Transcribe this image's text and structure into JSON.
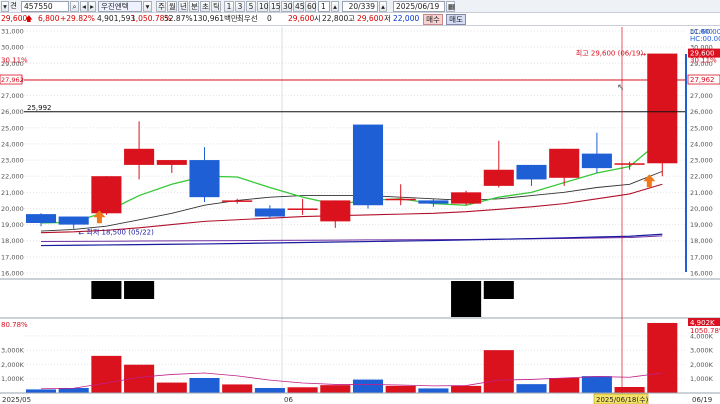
{
  "toolbar": {
    "prefix_label": "견",
    "stock_code": "457550",
    "stock_name": "우진엔텍",
    "period_tabs": [
      "주",
      "월",
      "년",
      "분",
      "초",
      "틱"
    ],
    "interval_buttons": [
      "1",
      "3",
      "5",
      "10",
      "15",
      "30",
      "45",
      "60",
      "1"
    ],
    "page_count": "20/339",
    "date": "2025/06/19",
    "buy_label": "매수",
    "sell_label": "매도"
  },
  "quote": {
    "price": "29,600",
    "change": "6,800",
    "change_pct": "+29.82%",
    "volume": "4,901,593",
    "volume_ratio": "1,050.78%",
    "turnover_ratio": "52.87%",
    "amount": "130,961백만",
    "preferred_label": "최우선",
    "preferred_value": "0",
    "open_value": "29,600",
    "open_label": "시",
    "low_value": "22,800",
    "high_label": "고",
    "high_value": "29,600",
    "low_label": "저",
    "close_value": "22,000"
  },
  "price_axis": {
    "ticks": [
      "31,000",
      "30,000",
      "29,000",
      "28,000",
      "27,000",
      "26,000",
      "25,000",
      "24,000",
      "23,000",
      "22,000",
      "21,000",
      "20,000",
      "19,000",
      "18,000",
      "17,000",
      "16,000"
    ],
    "left_ticks": [
      "30.11%"
    ],
    "lc_label": "LC:60.00",
    "hc_label": "HC:00.00",
    "current_price_tag": "29,600",
    "current_pct_tag": "30.11%",
    "ref_tag": "27,962",
    "ref_tag_left": "27,962",
    "level_line_label": "25,992",
    "high_annotation": "최고 29,600 (06/19)",
    "low_annotation": "최저 18,500 (05/22)"
  },
  "volume_axis": {
    "ticks": [
      "3,000K",
      "2,000K",
      "1,000K"
    ],
    "right_ticks": [
      "4,000K",
      "3,000K",
      "2,000K",
      "1,000K"
    ],
    "top_left_pct": "80.78%",
    "top_right_tag": "4,902K",
    "top_right_pct": "1050.78%"
  },
  "date_axis": {
    "labels": [
      "2025/05",
      "06"
    ],
    "cursor_date": "2025/06/18(수)",
    "right_date": "06/19"
  },
  "colors": {
    "up": "#d9121e",
    "down": "#1f5fd6",
    "ma5": "#38c838",
    "ma10": "#333333",
    "ma20": "#b0102a",
    "ma60": "#1a1aa0",
    "ma120": "#7030a0"
  },
  "chart_data": {
    "type": "candlestick",
    "price_range": [
      15500,
      31300
    ],
    "candles": [
      {
        "open": 19650,
        "high": 19700,
        "low": 18900,
        "close": 19100,
        "volume": 250
      },
      {
        "open": 19500,
        "high": 19500,
        "low": 18700,
        "close": 19000,
        "volume": 350
      },
      {
        "open": 19700,
        "high": 22000,
        "low": 19600,
        "close": 22000,
        "volume": 2600
      },
      {
        "open": 22700,
        "high": 25400,
        "low": 21800,
        "close": 23700,
        "volume": 1980
      },
      {
        "open": 22700,
        "high": 23000,
        "low": 22200,
        "close": 23000,
        "volume": 730
      },
      {
        "open": 23000,
        "high": 23800,
        "low": 20400,
        "close": 20700,
        "volume": 1050
      },
      {
        "open": 20500,
        "high": 20600,
        "low": 20300,
        "close": 20500,
        "volume": 600
      },
      {
        "open": 20000,
        "high": 20200,
        "low": 19400,
        "close": 19500,
        "volume": 350
      },
      {
        "open": 20000,
        "high": 20600,
        "low": 19600,
        "close": 20000,
        "volume": 400
      },
      {
        "open": 19200,
        "high": 20500,
        "low": 18800,
        "close": 20500,
        "volume": 550
      },
      {
        "open": 25200,
        "high": 25200,
        "low": 20000,
        "close": 20200,
        "volume": 940
      },
      {
        "open": 20600,
        "high": 21500,
        "low": 20200,
        "close": 20600,
        "volume": 500
      },
      {
        "open": 20500,
        "high": 20600,
        "low": 20100,
        "close": 20300,
        "volume": 320
      },
      {
        "open": 20300,
        "high": 21100,
        "low": 20200,
        "close": 21000,
        "volume": 500
      },
      {
        "open": 21400,
        "high": 24200,
        "low": 21300,
        "close": 22400,
        "volume": 3000
      },
      {
        "open": 22700,
        "high": 22700,
        "low": 21400,
        "close": 21800,
        "volume": 620
      },
      {
        "open": 21900,
        "high": 23700,
        "low": 21400,
        "close": 23700,
        "volume": 1050
      },
      {
        "open": 23400,
        "high": 24700,
        "low": 22200,
        "close": 22500,
        "volume": 1180
      },
      {
        "open": 22800,
        "high": 22900,
        "low": 22400,
        "close": 22800,
        "volume": 420
      },
      {
        "open": 22800,
        "high": 29600,
        "low": 22000,
        "close": 29600,
        "volume": 4902
      }
    ],
    "ma5": [
      19100,
      19150,
      19800,
      20800,
      21500,
      22000,
      21950,
      21300,
      20700,
      20250,
      20500,
      20600,
      20300,
      20200,
      20700,
      21000,
      21600,
      22200,
      22600,
      24300
    ],
    "ma10": [
      18600,
      18700,
      18900,
      19300,
      19700,
      20200,
      20500,
      20700,
      20800,
      20800,
      20800,
      20700,
      20600,
      20500,
      20600,
      20800,
      21000,
      21300,
      21500,
      22300
    ],
    "ma20": [
      18500,
      18550,
      18650,
      18800,
      19000,
      19200,
      19300,
      19400,
      19500,
      19550,
      19600,
      19650,
      19700,
      19800,
      19950,
      20100,
      20300,
      20600,
      20900,
      21500
    ],
    "ma60": [
      17700,
      17720,
      17740,
      17760,
      17780,
      17800,
      17830,
      17860,
      17890,
      17920,
      17950,
      17980,
      18010,
      18050,
      18090,
      18130,
      18180,
      18230,
      18280,
      18400
    ],
    "ma120": [
      17950,
      17960,
      17970,
      17980,
      17990,
      18000,
      18010,
      18020,
      18030,
      18040,
      18050,
      18060,
      18070,
      18080,
      18100,
      18120,
      18140,
      18170,
      18200,
      18300
    ],
    "volume_range": [
      0,
      4900
    ],
    "volume_ma": [
      300,
      330,
      700,
      1100,
      1300,
      1400,
      1200,
      900,
      700,
      600,
      600,
      560,
      500,
      520,
      900,
      950,
      1050,
      1150,
      1100,
      1400
    ]
  }
}
